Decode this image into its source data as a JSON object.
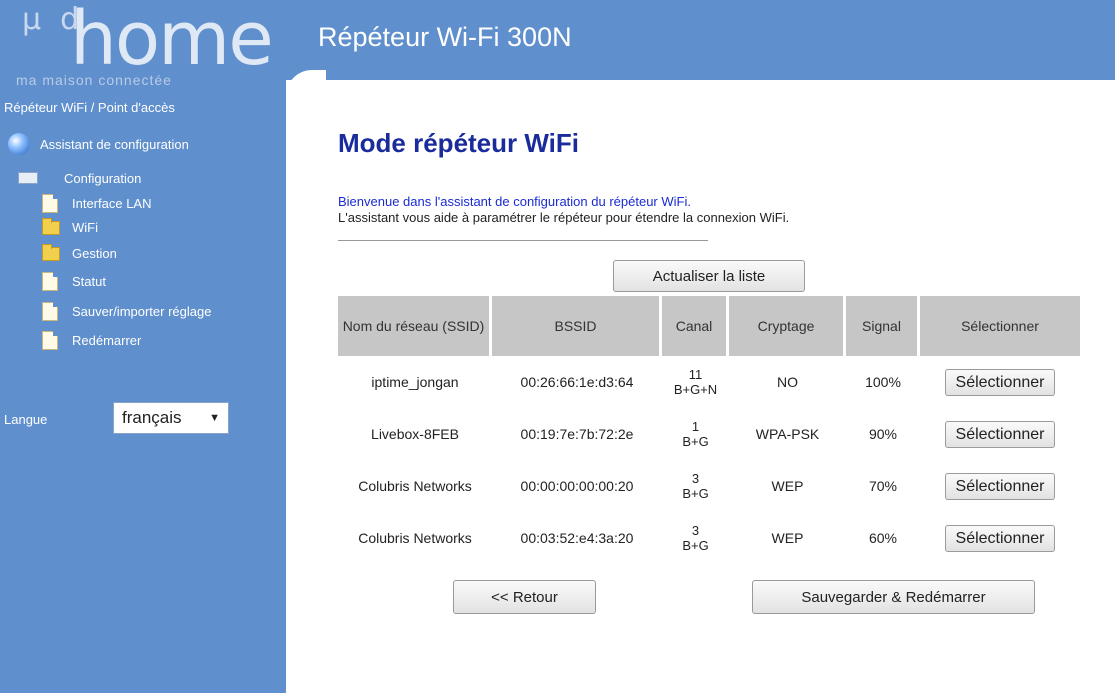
{
  "header": {
    "title": "Répéteur Wi-Fi 300N"
  },
  "logo": {
    "prefix": "μ  d",
    "word": "home",
    "tagline": "ma maison connectée"
  },
  "sidebar": {
    "subtitle": "Répéteur WiFi / Point d'accès",
    "wizard": "Assistant de configuration",
    "config": "Configuration",
    "items": [
      {
        "label": "Interface LAN",
        "icon": "document-icon"
      },
      {
        "label": "WiFi",
        "icon": "folder-icon"
      },
      {
        "label": "Gestion",
        "icon": "folder-icon"
      },
      {
        "label": "Statut",
        "icon": "document-icon"
      },
      {
        "label": "Sauver/importer réglage",
        "icon": "document-icon"
      },
      {
        "label": "Redémarrer",
        "icon": "document-icon"
      }
    ],
    "language_label": "Langue",
    "language_value": "français"
  },
  "main": {
    "title": "Mode répéteur WiFi",
    "welcome": "Bienvenue dans l'assistant de configuration du répéteur WiFi.",
    "help": "L'assistant vous aide à paramétrer le répéteur pour étendre la connexion WiFi.",
    "refresh_label": "Actualiser la liste",
    "back_label": "<< Retour",
    "save_label": "Sauvegarder & Redémarrer"
  },
  "table": {
    "headers": [
      "Nom du réseau (SSID)",
      "BSSID",
      "Canal",
      "Cryptage",
      "Signal",
      "Sélectionner"
    ],
    "rows": [
      {
        "ssid": "iptime_jongan",
        "bssid": "00:26:66:1e:d3:64",
        "channel": "11",
        "mode": "B+G+N",
        "crypt": "NO",
        "signal": "100%",
        "select": "Sélectionner"
      },
      {
        "ssid": "Livebox-8FEB",
        "bssid": "00:19:7e:7b:72:2e",
        "channel": "1",
        "mode": "B+G",
        "crypt": "WPA-PSK",
        "signal": "90%",
        "select": "Sélectionner"
      },
      {
        "ssid": "Colubris Networks",
        "bssid": "00:00:00:00:00:20",
        "channel": "3",
        "mode": "B+G",
        "crypt": "WEP",
        "signal": "70%",
        "select": "Sélectionner"
      },
      {
        "ssid": "Colubris Networks",
        "bssid": "00:03:52:e4:3a:20",
        "channel": "3",
        "mode": "B+G",
        "crypt": "WEP",
        "signal": "60%",
        "select": "Sélectionner"
      }
    ]
  },
  "colors": {
    "sidebar_bg": "#5f8fcc",
    "title": "#1a2b9c",
    "welcome": "#1a2bd0",
    "table_header": "#c6c6c6"
  }
}
